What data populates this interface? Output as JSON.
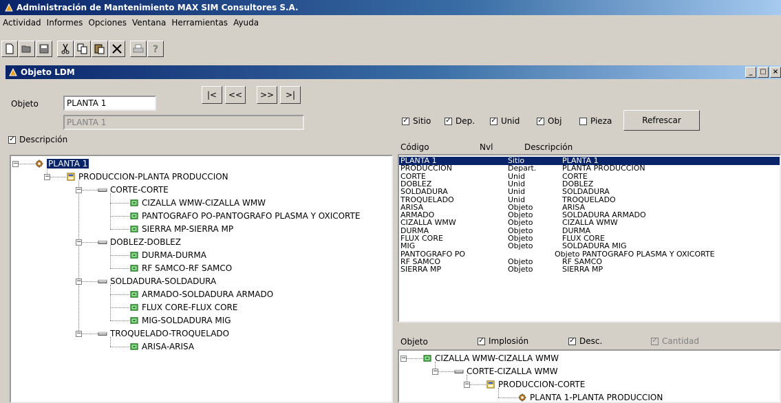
{
  "app": {
    "title": "Administración de Mantenimiento MAX    SIM Consultores S.A."
  },
  "menu": [
    "Actividad",
    "Informes",
    "Opciones",
    "Ventana",
    "Herramientas",
    "Ayuda"
  ],
  "toolbar_icons": [
    "new-icon",
    "open-icon",
    "save-icon",
    "cut-icon",
    "copy-icon",
    "paste-icon",
    "delete-icon",
    "print-icon",
    "help-icon"
  ],
  "child": {
    "title": "Objeto LDM"
  },
  "form": {
    "objeto_label": "Objeto",
    "objeto_value": "PLANTA 1",
    "objeto_desc": "PLANTA 1",
    "nav": [
      "|<",
      "<<",
      ">>",
      ">|"
    ],
    "descripcion_label": "Descripción",
    "descripcion_checked": true
  },
  "filters": {
    "items": [
      {
        "label": "Sitio",
        "checked": true
      },
      {
        "label": "Dep.",
        "checked": true
      },
      {
        "label": "Unid",
        "checked": true
      },
      {
        "label": "Obj",
        "checked": true
      },
      {
        "label": "Pieza",
        "checked": false
      }
    ],
    "refresh_label": "Refrescar"
  },
  "left_tree": [
    {
      "level": 0,
      "type": "sitio",
      "label": "PLANTA 1",
      "selected": true
    },
    {
      "level": 1,
      "type": "depart",
      "label": "PRODUCCION-PLANTA PRODUCCION"
    },
    {
      "level": 2,
      "type": "unid",
      "label": "CORTE-CORTE"
    },
    {
      "level": 3,
      "type": "obj",
      "label": "CIZALLA WMW-CIZALLA WMW"
    },
    {
      "level": 3,
      "type": "obj",
      "label": "PANTOGRAFO PO-PANTOGRAFO PLASMA Y OXICORTE"
    },
    {
      "level": 3,
      "type": "obj",
      "label": "SIERRA MP-SIERRA MP"
    },
    {
      "level": 2,
      "type": "unid",
      "label": "DOBLEZ-DOBLEZ"
    },
    {
      "level": 3,
      "type": "obj",
      "label": "DURMA-DURMA"
    },
    {
      "level": 3,
      "type": "obj",
      "label": "RF SAMCO-RF SAMCO"
    },
    {
      "level": 2,
      "type": "unid",
      "label": "SOLDADURA-SOLDADURA"
    },
    {
      "level": 3,
      "type": "obj",
      "label": "ARMADO-SOLDADURA ARMADO"
    },
    {
      "level": 3,
      "type": "obj",
      "label": "FLUX CORE-FLUX CORE"
    },
    {
      "level": 3,
      "type": "obj",
      "label": "MIG-SOLDADURA MIG"
    },
    {
      "level": 2,
      "type": "unid",
      "label": "TROQUELADO-TROQUELADO"
    },
    {
      "level": 3,
      "type": "obj",
      "label": "ARISA-ARISA"
    }
  ],
  "list": {
    "headers": [
      "Código",
      "Nvl",
      "Descripción"
    ],
    "rows": [
      {
        "codigo": "PLANTA 1",
        "nvl": "Sitio",
        "desc": "PLANTA 1",
        "selected": true
      },
      {
        "codigo": "PRODUCCION",
        "nvl": "Depart.",
        "desc": "PLANTA PRODUCCION"
      },
      {
        "codigo": "CORTE",
        "nvl": "Unid",
        "desc": "CORTE"
      },
      {
        "codigo": "DOBLEZ",
        "nvl": "Unid",
        "desc": "DOBLEZ"
      },
      {
        "codigo": "SOLDADURA",
        "nvl": "Unid",
        "desc": "SOLDADURA"
      },
      {
        "codigo": "TROQUELADO",
        "nvl": "Unid",
        "desc": "TROQUELADO"
      },
      {
        "codigo": "ARISA",
        "nvl": "Objeto",
        "desc": "ARISA"
      },
      {
        "codigo": "ARMADO",
        "nvl": "Objeto",
        "desc": "SOLDADURA ARMADO"
      },
      {
        "codigo": "CIZALLA WMW",
        "nvl": "Objeto",
        "desc": "CIZALLA WMW"
      },
      {
        "codigo": "DURMA",
        "nvl": "Objeto",
        "desc": "DURMA"
      },
      {
        "codigo": "FLUX CORE",
        "nvl": "Objeto",
        "desc": "FLUX CORE"
      },
      {
        "codigo": "MIG",
        "nvl": "Objeto",
        "desc": "SOLDADURA MIG"
      },
      {
        "codigo": "PANTOGRAFO PO",
        "nvl": "",
        "desc": "Objeto    PANTOGRAFO PLASMA Y OXICORTE"
      },
      {
        "codigo": "RF SAMCO",
        "nvl": "Objeto",
        "desc": "RF SAMCO"
      },
      {
        "codigo": "SIERRA MP",
        "nvl": "Objeto",
        "desc": "SIERRA MP"
      }
    ]
  },
  "bottom": {
    "objeto_label": "Objeto",
    "checks": [
      {
        "label": "Implosión",
        "checked": true,
        "disabled": false
      },
      {
        "label": "Desc.",
        "checked": true,
        "disabled": false
      },
      {
        "label": "Cantidad",
        "checked": true,
        "disabled": true
      }
    ],
    "tree": [
      {
        "level": 0,
        "type": "obj",
        "label": "CIZALLA WMW-CIZALLA WMW"
      },
      {
        "level": 1,
        "type": "unid",
        "label": "CORTE-CIZALLA WMW"
      },
      {
        "level": 2,
        "type": "depart",
        "label": "PRODUCCION-CORTE"
      },
      {
        "level": 3,
        "type": "sitio",
        "label": "PLANTA 1-PLANTA PRODUCCION"
      }
    ]
  },
  "colors": {
    "selection": "#0a246a",
    "face": "#d4d0c8"
  }
}
